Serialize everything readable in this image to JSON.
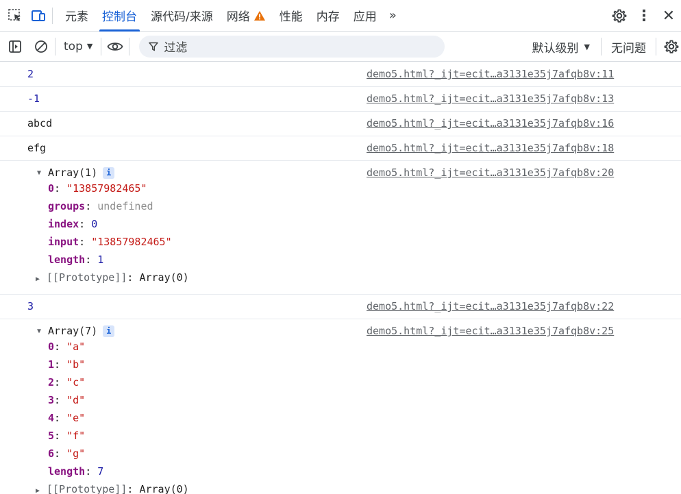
{
  "tabs": {
    "items": [
      "元素",
      "控制台",
      "源代码/来源",
      "网络",
      "性能",
      "内存",
      "应用"
    ],
    "more": "»"
  },
  "toolbar": {
    "context": "top",
    "filter_placeholder": "过滤",
    "level": "默认级别",
    "issues": "无问题"
  },
  "colors": {
    "accent": "#1a62d6",
    "warning": "#e8710a",
    "string": "#c41a16",
    "key": "#881280",
    "number": "#1a1aa6"
  },
  "console": {
    "messages": [
      {
        "text": "2",
        "source": "demo5.html?_ijt=ecit…a3131e35j7afqb8v:11"
      },
      {
        "text": "-1",
        "source": "demo5.html?_ijt=ecit…a3131e35j7afqb8v:13"
      },
      {
        "text": "abcd",
        "source": "demo5.html?_ijt=ecit…a3131e35j7afqb8v:16"
      },
      {
        "text": "efg",
        "source": "demo5.html?_ijt=ecit…a3131e35j7afqb8v:18"
      }
    ],
    "array1": {
      "header": "Array(1)",
      "source": "demo5.html?_ijt=ecit…a3131e35j7afqb8v:20",
      "props": [
        {
          "key": "0",
          "sep": ": ",
          "value": "\"13857982465\""
        },
        {
          "key": "groups",
          "sep": ": ",
          "value": "undefined"
        },
        {
          "key": "index",
          "sep": ": ",
          "value": "0"
        },
        {
          "key": "input",
          "sep": ": ",
          "value": "\"13857982465\""
        },
        {
          "key": "length",
          "sep": ": ",
          "value": "1"
        }
      ],
      "proto_key": "[[Prototype]]",
      "proto_val": "Array(0)"
    },
    "msg3": {
      "text": "3",
      "source": "demo5.html?_ijt=ecit…a3131e35j7afqb8v:22"
    },
    "array7": {
      "header": "Array(7)",
      "source": "demo5.html?_ijt=ecit…a3131e35j7afqb8v:25",
      "props": [
        {
          "key": "0",
          "sep": ": ",
          "value": "\"a\""
        },
        {
          "key": "1",
          "sep": ": ",
          "value": "\"b\""
        },
        {
          "key": "2",
          "sep": ": ",
          "value": "\"c\""
        },
        {
          "key": "3",
          "sep": ": ",
          "value": "\"d\""
        },
        {
          "key": "4",
          "sep": ": ",
          "value": "\"e\""
        },
        {
          "key": "5",
          "sep": ": ",
          "value": "\"f\""
        },
        {
          "key": "6",
          "sep": ": ",
          "value": "\"g\""
        },
        {
          "key": "length",
          "sep": ": ",
          "value": "7"
        }
      ],
      "proto_key": "[[Prototype]]",
      "proto_val": "Array(0)"
    },
    "info_badge": "i"
  }
}
